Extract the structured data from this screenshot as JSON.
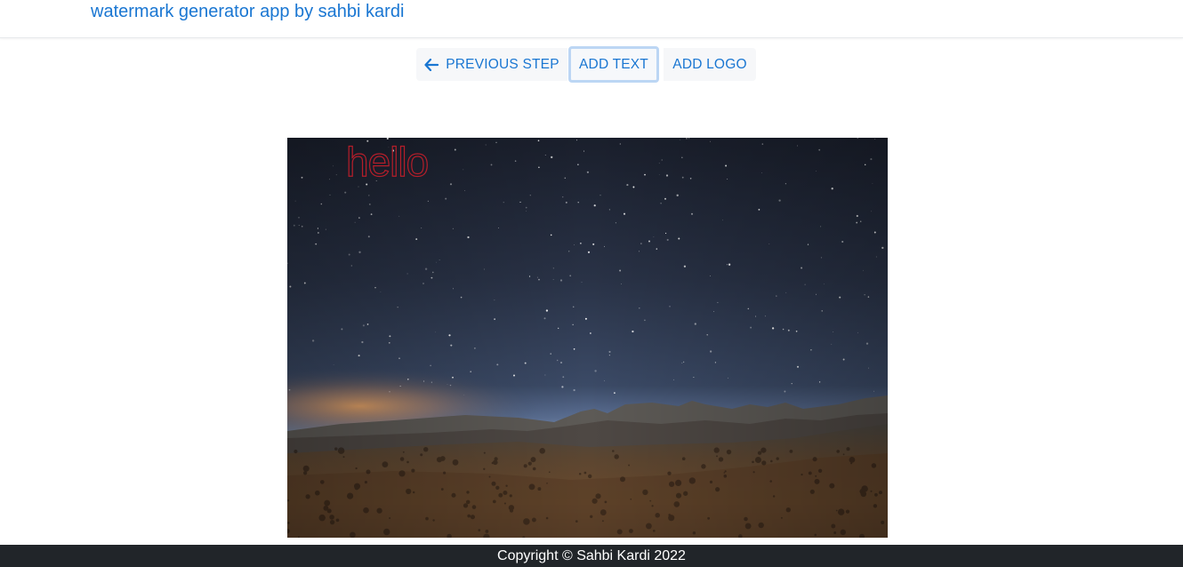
{
  "header": {
    "brand": "watermark generator app by sahbi kardi"
  },
  "toolbar": {
    "previous_label": "PREVIOUS STEP",
    "add_text_label": "ADD TEXT",
    "add_logo_label": "ADD LOGO",
    "arrow_icon": "arrow-left-icon"
  },
  "canvas": {
    "watermark_text": "hello",
    "watermark_color": "#b51e2a"
  },
  "footer": {
    "copyright": "Copyright © Sahbi Kardi 2022"
  },
  "colors": {
    "accent": "#1976d2",
    "footer_bg": "#212529"
  }
}
